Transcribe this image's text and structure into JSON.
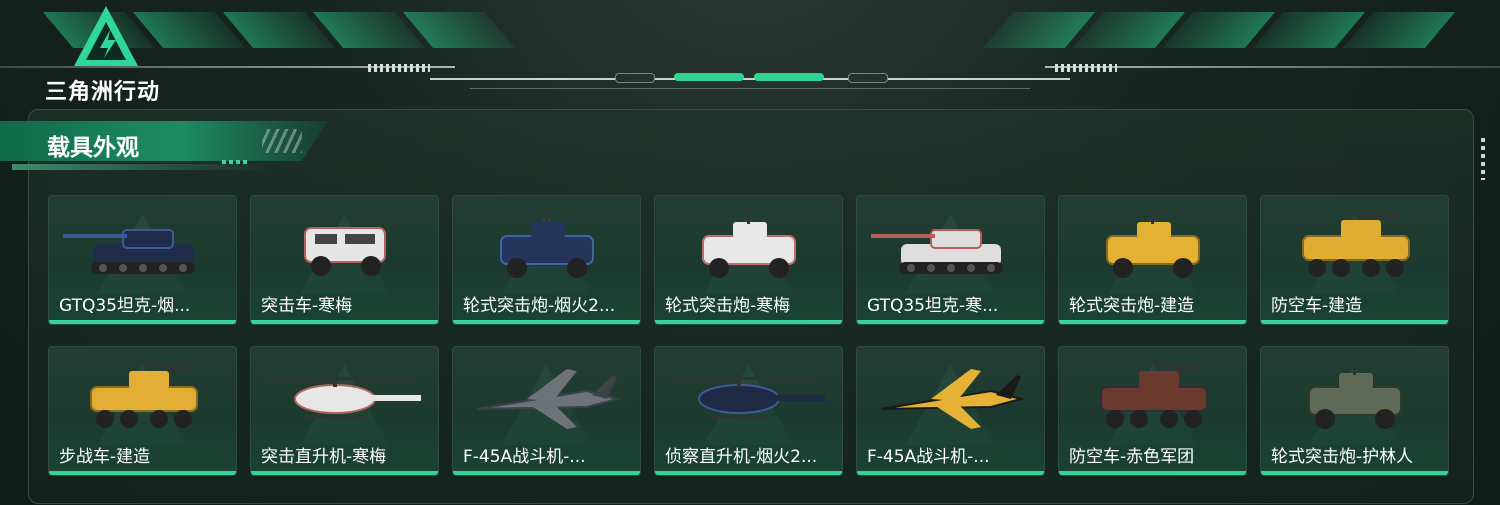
{
  "app": {
    "logo_text": "三角洲行动"
  },
  "section": {
    "title": "载具外观"
  },
  "colors": {
    "accent": "#37d49a",
    "panel_bg": "#1a3a2e"
  },
  "cards": [
    {
      "label": "GTQ35坦克-烟...",
      "kind": "tank",
      "color": "#1f2c4a",
      "accent": "#3b5a9a"
    },
    {
      "label": "突击车-寒梅",
      "kind": "truck",
      "color": "#e6e6e6",
      "accent": "#b86060"
    },
    {
      "label": "轮式突击炮-烟火2...",
      "kind": "wheeled",
      "color": "#24345a",
      "accent": "#3f64a8"
    },
    {
      "label": "轮式突击炮-寒梅",
      "kind": "wheeled",
      "color": "#e8e8e8",
      "accent": "#c06c6c"
    },
    {
      "label": "GTQ35坦克-寒...",
      "kind": "tank",
      "color": "#dedede",
      "accent": "#b45d5d"
    },
    {
      "label": "轮式突击炮-建造",
      "kind": "wheeled",
      "color": "#e3b133",
      "accent": "#8a6a22"
    },
    {
      "label": "防空车-建造",
      "kind": "apc",
      "color": "#e0ad33",
      "accent": "#8b6a1f"
    },
    {
      "label": "步战车-建造",
      "kind": "apc",
      "color": "#e3ae35",
      "accent": "#8b6a1f"
    },
    {
      "label": "突击直升机-寒梅",
      "kind": "heli",
      "color": "#e7e7e7",
      "accent": "#b56363"
    },
    {
      "label": "F-45A战斗机-...",
      "kind": "jet",
      "color": "#6d7378",
      "accent": "#3c4247"
    },
    {
      "label": "侦察直升机-烟火2...",
      "kind": "heli",
      "color": "#1f2a45",
      "accent": "#3e5a96"
    },
    {
      "label": "F-45A战斗机-...",
      "kind": "jet",
      "color": "#e5b236",
      "accent": "#1a1a1a"
    },
    {
      "label": "防空车-赤色军团",
      "kind": "apc",
      "color": "#6a3a2f",
      "accent": "#2f2f2f"
    },
    {
      "label": "轮式突击炮-护林人",
      "kind": "wheeled",
      "color": "#5f6a56",
      "accent": "#2f3a2d"
    }
  ]
}
